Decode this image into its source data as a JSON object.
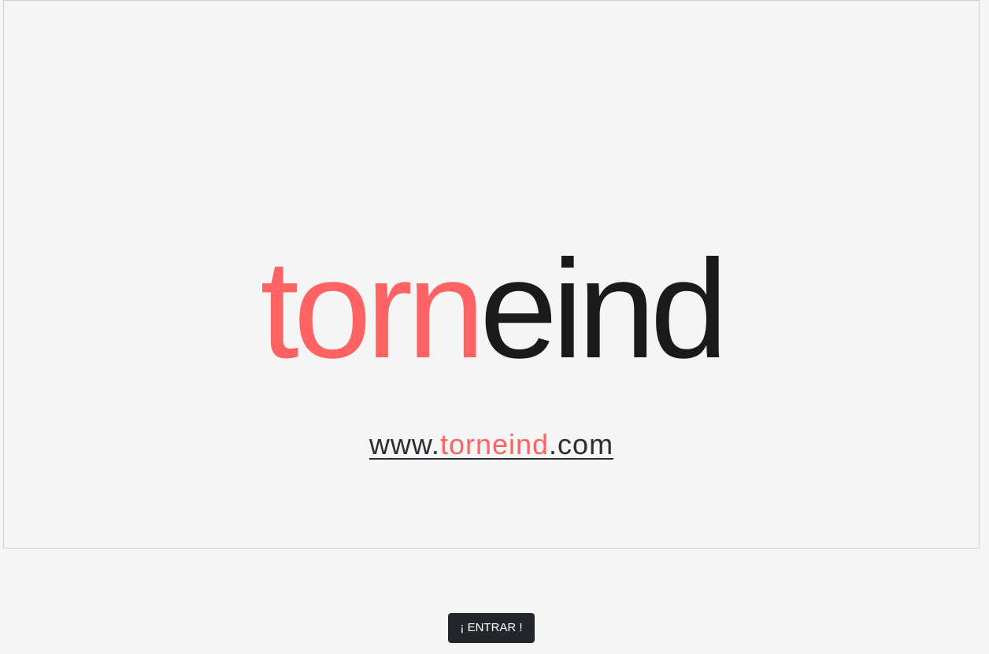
{
  "colors": {
    "accent": "#ff6262",
    "dark": "#1a1a1a",
    "link": "#2b2d33",
    "button_bg": "#23262b"
  },
  "splash": {
    "logo": {
      "part_a": "torn",
      "part_b": "eind"
    },
    "url": {
      "prefix": "www.",
      "middle": "torneind",
      "suffix": ".com"
    }
  },
  "enter_button": {
    "label": "¡ ENTRAR !"
  }
}
